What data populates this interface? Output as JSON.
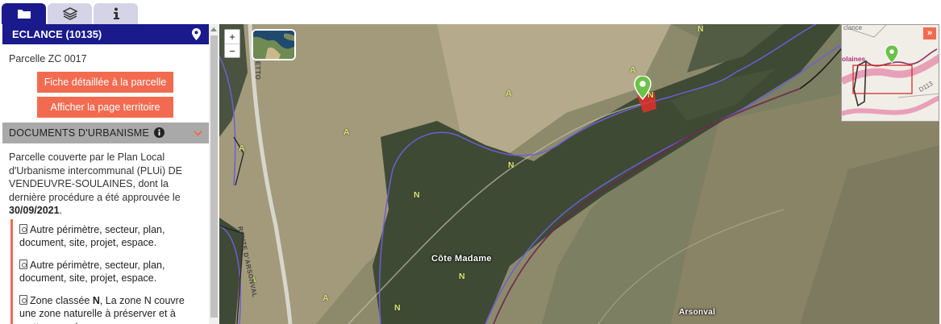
{
  "tabs": [
    {
      "name": "folder-icon",
      "active": true
    },
    {
      "name": "layers-icon",
      "active": false
    },
    {
      "name": "info-icon",
      "active": false
    }
  ],
  "parcel": {
    "commune": "ECLANCE (10135)",
    "location_icon": "map-marker-icon",
    "label": "Parcelle ZC 0017",
    "buttons": {
      "fiche": "Fiche détaillée à la parcelle",
      "territoire": "Afficher la page territoire"
    }
  },
  "documents": {
    "header": "DOCUMENTS D'URBANISME",
    "info_icon": "info-circle-icon",
    "chevron_icon": "chevron-down-icon",
    "intro_pre": "Parcelle couverte par le Plan Local d'Urbanisme intercommunal (PLUi) DE VENDEUVRE-SOULAINES, dont la dernière procédure a été approuvée le ",
    "intro_date": "30/09/2021",
    "intro_post": ".",
    "items": [
      {
        "text": "Autre périmètre, secteur, plan, document, site, projet, espace."
      },
      {
        "text": "Autre périmètre, secteur, plan, document, site, projet, espace."
      },
      {
        "pre": "Zone classée ",
        "zone": "N",
        "post": ", La zone N couvre une zone naturelle à préserver et à mettre en valeur."
      }
    ]
  },
  "map": {
    "zoom_in": "+",
    "zoom_out": "−",
    "zone_labels": [
      {
        "text": "N"
      },
      {
        "text": "A"
      },
      {
        "text": "A"
      },
      {
        "text": "A"
      },
      {
        "text": "A"
      },
      {
        "text": "N"
      },
      {
        "text": "N"
      },
      {
        "text": "N"
      },
      {
        "text": "N"
      },
      {
        "text": "A"
      },
      {
        "text": "A"
      },
      {
        "text": "N"
      },
      {
        "text": "N"
      }
    ],
    "places": {
      "cote_madame": "Côte Madame",
      "arsonval": "Arsonval"
    },
    "roads": {
      "route_arsonval": "ROUTE D'ARSONVAL",
      "route_top": "ETTO"
    },
    "minimap": {
      "toggle": "»",
      "label_top": "clance",
      "label_pink": "olaines",
      "label_road": "D113"
    },
    "colors": {
      "accent_orange": "#f26b50",
      "navy": "#1a1a8c",
      "zone_outline": "#6b5fd6",
      "parcel_red": "#e0302a",
      "marker_green": "#6bc24a"
    }
  }
}
